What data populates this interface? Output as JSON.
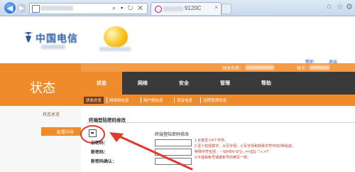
{
  "browser": {
    "back_icon": "back-arrow-icon",
    "forward_icon": "forward-arrow-icon",
    "address_tools": "⌕ ▾ ↻ ✕",
    "tab_title_partial": "9120C",
    "tab_close": "×",
    "icons": [
      "home-icon",
      "star-icon",
      "gear-icon"
    ]
  },
  "header": {
    "logo_text": "中国电信",
    "help_link": "帮助",
    "logout_link": "退出",
    "net_name_label": "网关名称：",
    "account_label": "帐号："
  },
  "left": {
    "title": "状态",
    "menu": [
      "状态总览",
      "配置向导"
    ]
  },
  "nav": {
    "tabs": [
      "状态",
      "网络",
      "安全",
      "管理",
      "帮助"
    ],
    "subtabs": [
      "状态总览",
      "网络侧信息",
      "用户侧信息",
      "语音信息",
      "远程管理状态"
    ]
  },
  "content": {
    "section_title": "终端登陆密码修改",
    "checkbox_label": "终端登陆密码修改",
    "fields": [
      "旧密码：",
      "新密码：",
      "新密码确认："
    ],
    "hints": [
      "1.长度至少8个字符。",
      "2.至少包括数字、大写字母、小写字母和特殊字符中的2种组成。",
      "特殊字符包括：`~!@#$%^&*()-_=+\\|[{}];:'\",<.>/?",
      "3.不能和帐号或者帐号的倒写一样。"
    ]
  },
  "colors": {
    "accent_orange": "#f08b2c",
    "nav_dark": "#3a3a3a",
    "annotation_red": "#e03a2f"
  }
}
